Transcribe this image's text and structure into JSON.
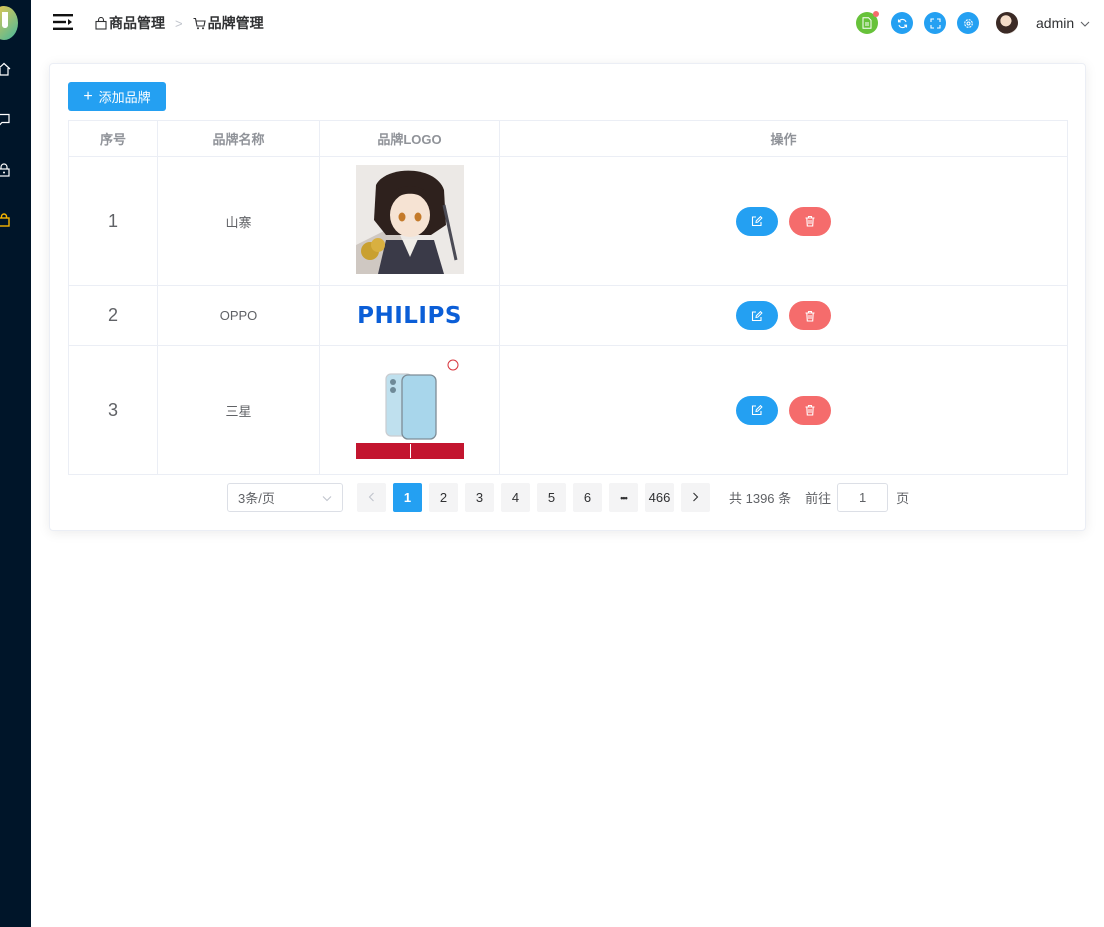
{
  "sidebar": {
    "items": [
      {
        "icon": "home-icon"
      },
      {
        "icon": "message-icon"
      },
      {
        "icon": "lock-icon"
      },
      {
        "icon": "shopping-bag-icon",
        "active": true
      }
    ]
  },
  "header": {
    "breadcrumb": [
      {
        "label": "商品管理",
        "icon": "bag-icon"
      },
      {
        "label": "品牌管理",
        "icon": "cart-icon"
      }
    ],
    "tools": [
      {
        "icon": "document-icon",
        "color": "#67c23a"
      },
      {
        "icon": "refresh-icon",
        "color": "#24a0f2"
      },
      {
        "icon": "fullscreen-icon",
        "color": "#24a0f2"
      },
      {
        "icon": "settings-icon",
        "color": "#24a0f2"
      }
    ],
    "user": "admin"
  },
  "toolbar": {
    "add_label": "添加品牌"
  },
  "table": {
    "columns": [
      "序号",
      "品牌名称",
      "品牌LOGO",
      "操作"
    ],
    "rows": [
      {
        "index": "1",
        "name": "山寨",
        "logo": "anime-character-image"
      },
      {
        "index": "2",
        "name": "OPPO",
        "logo": "PHILIPS"
      },
      {
        "index": "3",
        "name": "三星",
        "logo": "phone-product-image"
      }
    ]
  },
  "pagination": {
    "page_size": "3条/页",
    "pages": [
      "1",
      "2",
      "3",
      "4",
      "5",
      "6"
    ],
    "ellipsis": "•••",
    "last_page": "466",
    "current": "1",
    "total": "共 1396 条",
    "goto_label": "前往",
    "goto_value": "1",
    "page_suffix": "页"
  },
  "colors": {
    "primary": "#24a0f2",
    "danger": "#f56c6c",
    "success": "#67c23a",
    "sidebar": "#001529"
  }
}
